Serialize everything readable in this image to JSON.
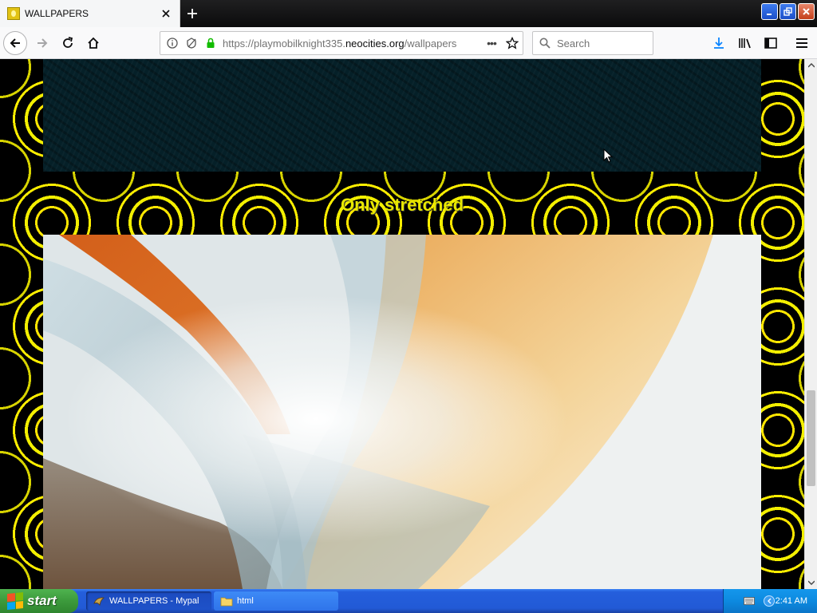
{
  "browser": {
    "tab": {
      "title": "WALLPAPERS"
    },
    "address_bar": {
      "prefix": "https://playmobilknight335.",
      "domain": "neocities.org",
      "path": "/wallpapers"
    },
    "search": {
      "placeholder": "Search"
    },
    "page_actions_label": "•••"
  },
  "page": {
    "section_title": "Only stretched"
  },
  "taskbar": {
    "start_label": "start",
    "tasks": [
      {
        "label": "WALLPAPERS - Mypal",
        "active": true
      },
      {
        "label": "html",
        "active": false
      }
    ],
    "clock": "2:41 AM"
  },
  "colors": {
    "page_title_yellow": "#e8e800",
    "pattern_yellow": "#ffe600",
    "panel_teal": "#052028",
    "xp_blue": "#245edc",
    "start_green": "#3c9a3c"
  },
  "scroll_position": 0.78
}
